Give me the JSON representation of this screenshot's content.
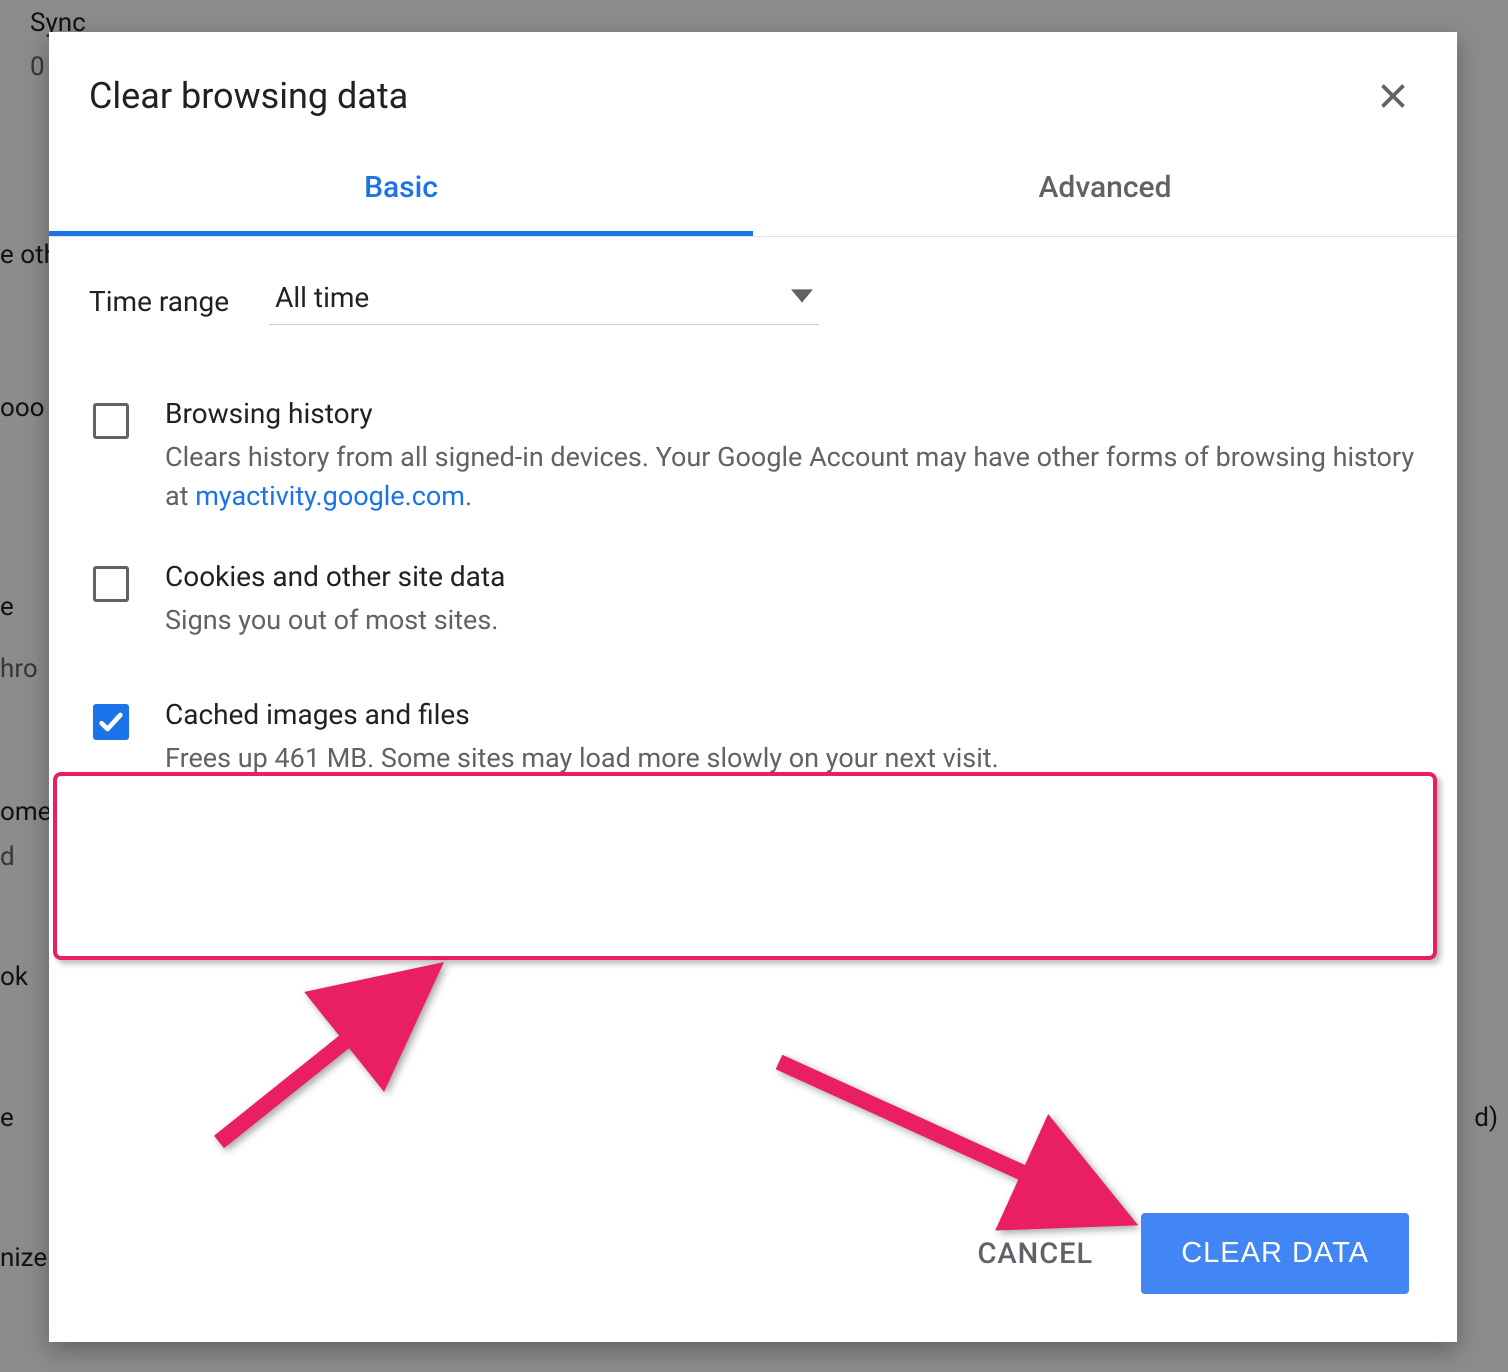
{
  "background": {
    "items": [
      "Sync",
      "e other",
      "ooo",
      "e",
      "hro",
      "ome",
      "d",
      "ok",
      "e",
      "nize",
      "d)"
    ],
    "zero": "0"
  },
  "dialog": {
    "title": "Clear browsing data",
    "tabs": {
      "basic": "Basic",
      "advanced": "Advanced"
    },
    "time_range": {
      "label": "Time range",
      "value": "All time"
    },
    "options": {
      "browsing_history": {
        "title": "Browsing history",
        "desc_prefix": "Clears history from all signed-in devices. Your Google Account may have other forms of browsing history at ",
        "link_text": "myactivity.google.com",
        "desc_suffix": ".",
        "checked": false
      },
      "cookies": {
        "title": "Cookies and other site data",
        "desc": "Signs you out of most sites.",
        "checked": false
      },
      "cached": {
        "title": "Cached images and files",
        "desc": "Frees up 461 MB. Some sites may load more slowly on your next visit.",
        "checked": true
      }
    },
    "buttons": {
      "cancel": "CANCEL",
      "clear": "CLEAR DATA"
    }
  },
  "colors": {
    "accent": "#1a73e8",
    "annotation": "#e91e63"
  }
}
